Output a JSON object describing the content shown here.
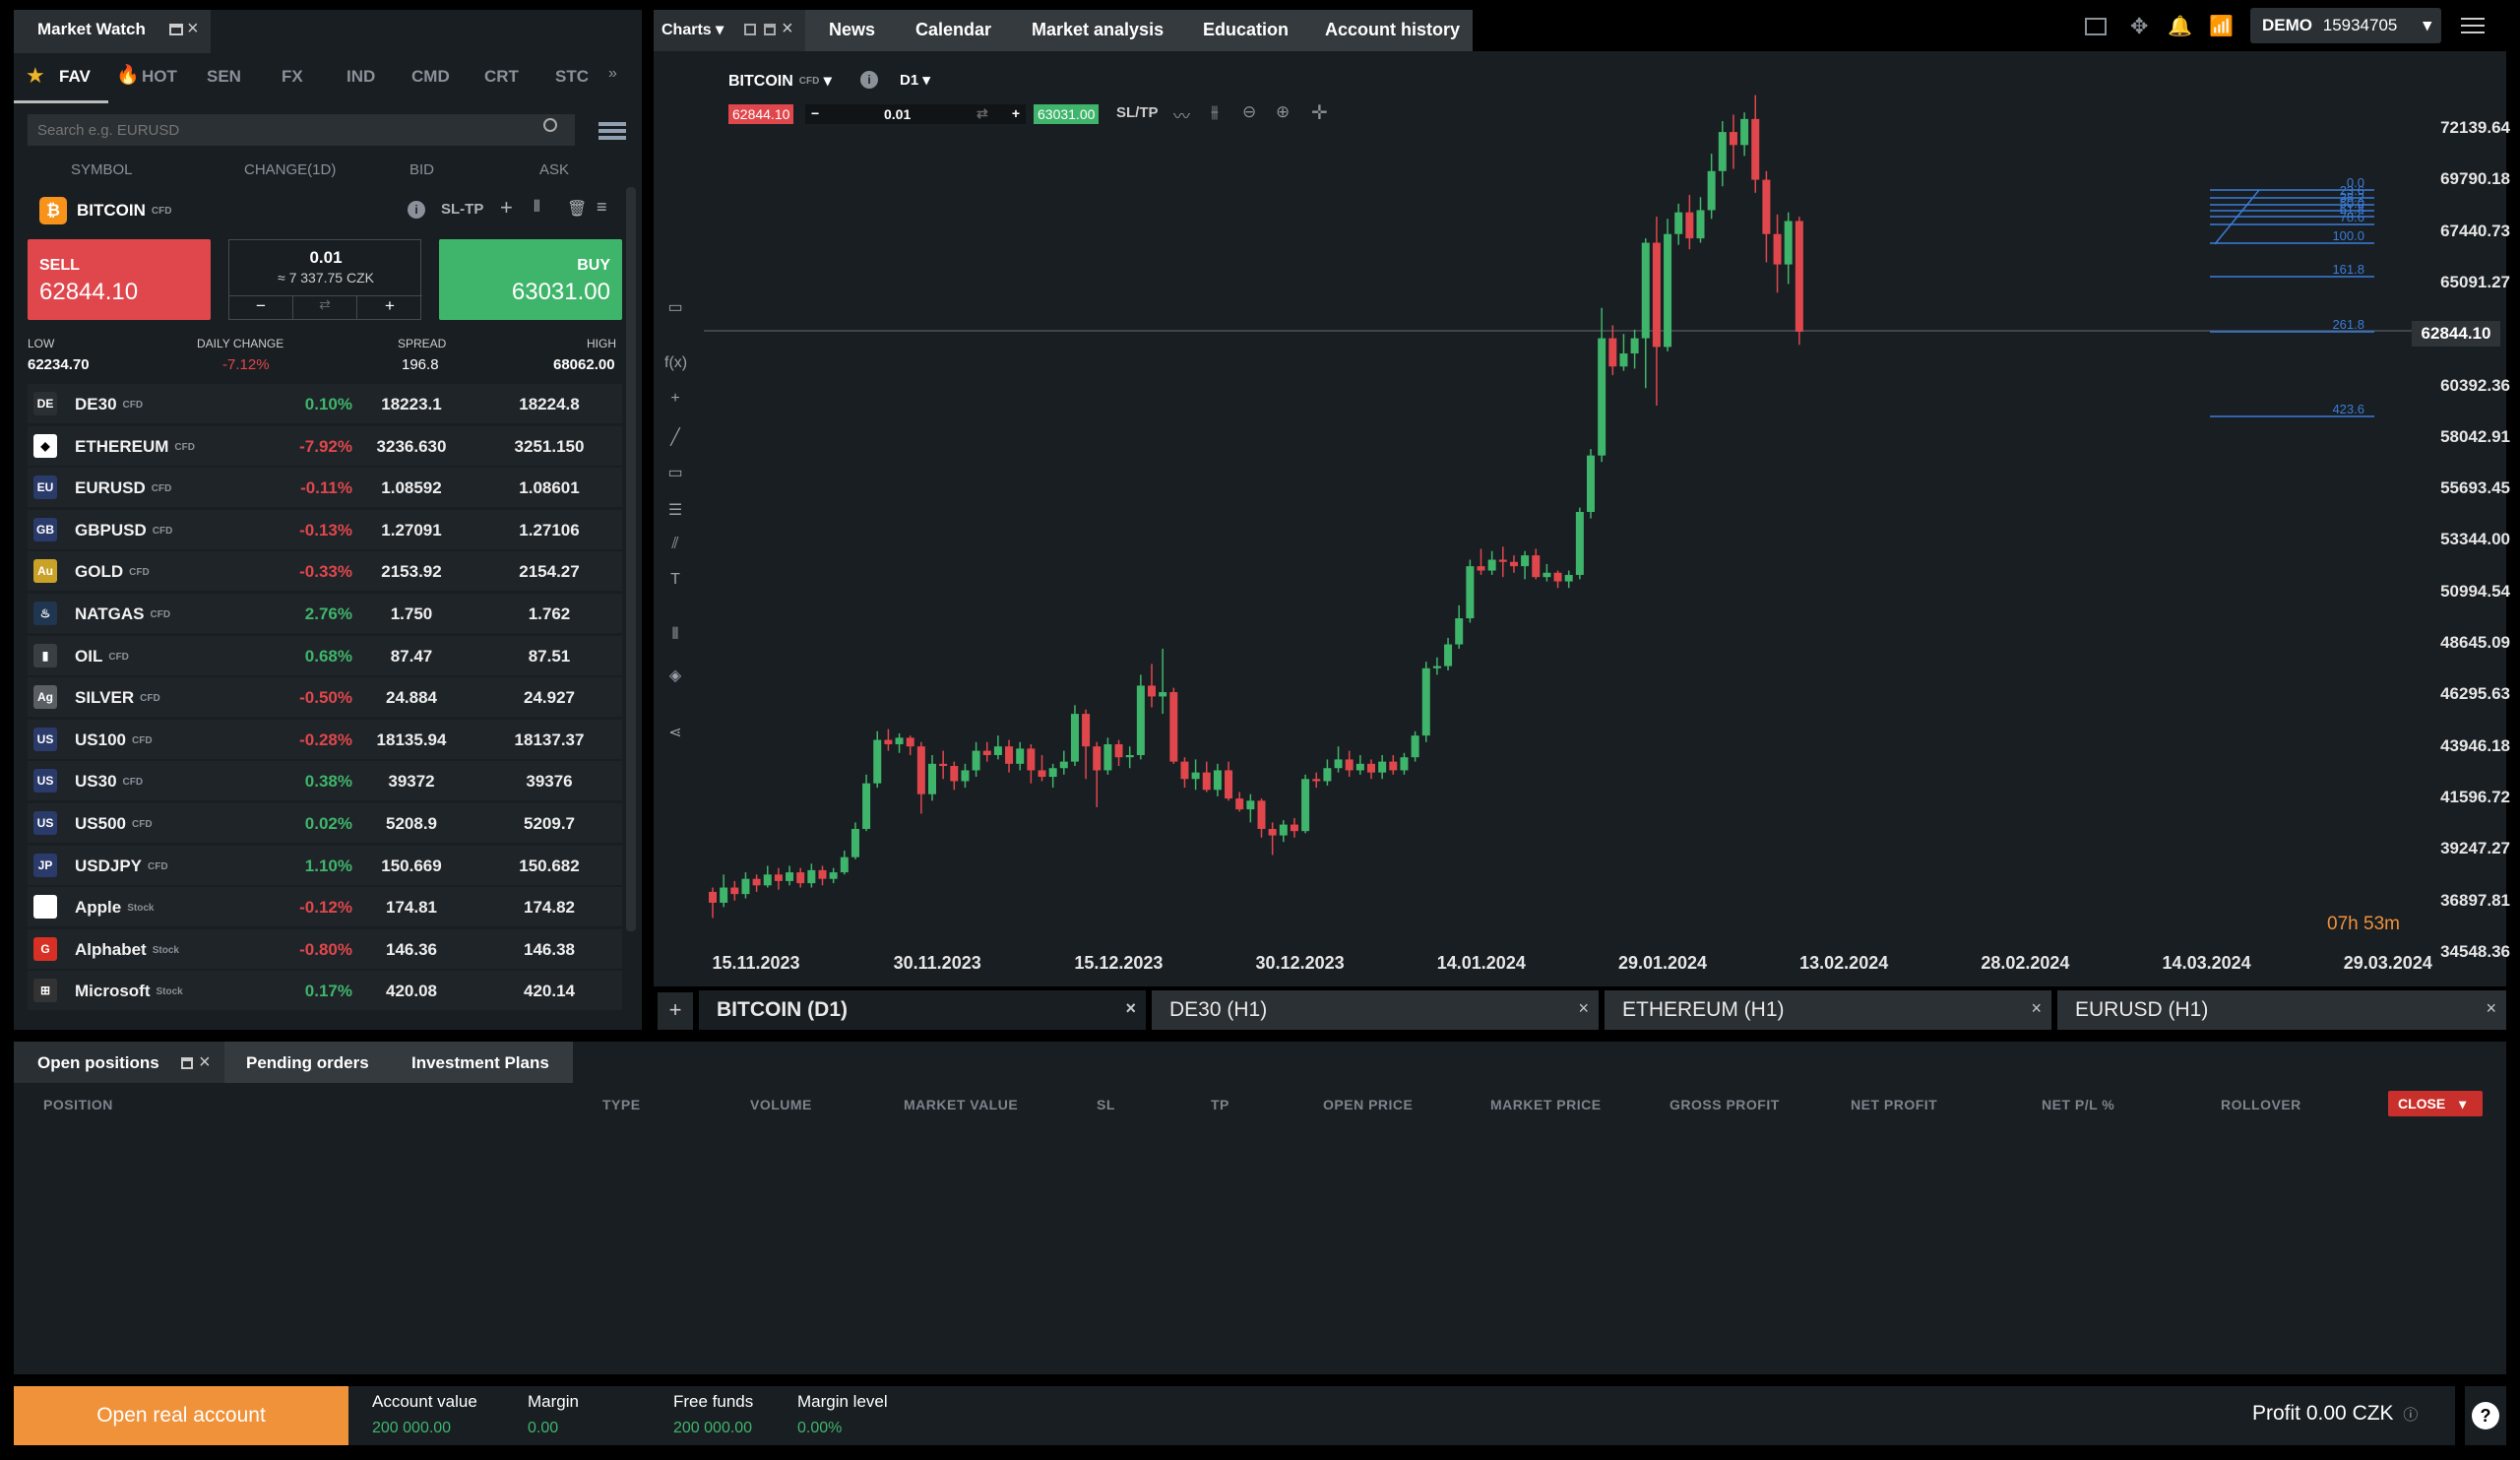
{
  "market_watch": {
    "title": "Market Watch",
    "tabs": [
      "FAV",
      "HOT",
      "SEN",
      "FX",
      "IND",
      "CMD",
      "CRT",
      "STC"
    ],
    "search_placeholder": "Search e.g. EURUSD",
    "columns": [
      "SYMBOL",
      "CHANGE(1D)",
      "BID",
      "ASK"
    ],
    "selected": {
      "symbol": "BITCOIN",
      "type": "CFD",
      "sltp": "SL-TP",
      "sell_label": "SELL",
      "sell_price": "62844.10",
      "buy_label": "BUY",
      "buy_price": "63031.00",
      "volume": "0.01",
      "volume_czk": "≈ 7 337.75 CZK",
      "minus": "−",
      "plus": "+",
      "swap": "⇄",
      "low_label": "LOW",
      "low": "62234.70",
      "daily_label": "DAILY CHANGE",
      "daily": "-7.12%",
      "spread_label": "SPREAD",
      "spread": "196.8",
      "high_label": "HIGH",
      "high": "68062.00"
    },
    "rows": [
      {
        "symbol": "DE30",
        "type": "CFD",
        "change": "0.10%",
        "bid": "18223.1",
        "ask": "18224.8",
        "up": true,
        "color": "#2a2f33",
        "flag": "DE"
      },
      {
        "symbol": "ETHEREUM",
        "type": "CFD",
        "change": "-7.92%",
        "bid": "3236.630",
        "ask": "3251.150",
        "up": false,
        "color": "#ffffff",
        "flag": "◆"
      },
      {
        "symbol": "EURUSD",
        "type": "CFD",
        "change": "-0.11%",
        "bid": "1.08592",
        "ask": "1.08601",
        "up": false,
        "color": "#2a3a6a",
        "flag": "EU"
      },
      {
        "symbol": "GBPUSD",
        "type": "CFD",
        "change": "-0.13%",
        "bid": "1.27091",
        "ask": "1.27106",
        "up": false,
        "color": "#2a3a6a",
        "flag": "GB"
      },
      {
        "symbol": "GOLD",
        "type": "CFD",
        "change": "-0.33%",
        "bid": "2153.92",
        "ask": "2154.27",
        "up": false,
        "color": "#c9a227",
        "flag": "Au"
      },
      {
        "symbol": "NATGAS",
        "type": "CFD",
        "change": "2.76%",
        "bid": "1.750",
        "ask": "1.762",
        "up": true,
        "color": "#1f3550",
        "flag": "♨"
      },
      {
        "symbol": "OIL",
        "type": "CFD",
        "change": "0.68%",
        "bid": "87.47",
        "ask": "87.51",
        "up": true,
        "color": "#3a3f44",
        "flag": "▮"
      },
      {
        "symbol": "SILVER",
        "type": "CFD",
        "change": "-0.50%",
        "bid": "24.884",
        "ask": "24.927",
        "up": false,
        "color": "#5a5f64",
        "flag": "Ag"
      },
      {
        "symbol": "US100",
        "type": "CFD",
        "change": "-0.28%",
        "bid": "18135.94",
        "ask": "18137.37",
        "up": false,
        "color": "#2a3a6a",
        "flag": "US"
      },
      {
        "symbol": "US30",
        "type": "CFD",
        "change": "0.38%",
        "bid": "39372",
        "ask": "39376",
        "up": true,
        "color": "#2a3a6a",
        "flag": "US"
      },
      {
        "symbol": "US500",
        "type": "CFD",
        "change": "0.02%",
        "bid": "5208.9",
        "ask": "5209.7",
        "up": true,
        "color": "#2a3a6a",
        "flag": "US"
      },
      {
        "symbol": "USDJPY",
        "type": "CFD",
        "change": "1.10%",
        "bid": "150.669",
        "ask": "150.682",
        "up": true,
        "color": "#2a3a6a",
        "flag": "JP"
      },
      {
        "symbol": "Apple",
        "type": "Stock",
        "change": "-0.12%",
        "bid": "174.81",
        "ask": "174.82",
        "up": false,
        "color": "#ffffff",
        "flag": ""
      },
      {
        "symbol": "Alphabet",
        "type": "Stock",
        "change": "-0.80%",
        "bid": "146.36",
        "ask": "146.38",
        "up": false,
        "color": "#d93025",
        "flag": "G"
      },
      {
        "symbol": "Microsoft",
        "type": "Stock",
        "change": "0.17%",
        "bid": "420.08",
        "ask": "420.14",
        "up": true,
        "color": "#333",
        "flag": "⊞"
      }
    ]
  },
  "top_nav": {
    "charts": "Charts",
    "items": [
      "News",
      "Calendar",
      "Market analysis",
      "Education",
      "Account history"
    ],
    "account_mode": "DEMO",
    "account_id": "15934705"
  },
  "chart": {
    "symbol": "BITCOIN",
    "type": "CFD",
    "timeframe": "D1",
    "sell_price": "62844.10",
    "buy_price": "63031.00",
    "volume": "0.01",
    "sltp": "SL/TP",
    "timer_h": "07",
    "timer_m": "53",
    "current_price": "62844.10",
    "y_ticks": [
      "72139.64",
      "69790.18",
      "67440.73",
      "65091.27",
      "62844.10",
      "60392.36",
      "58042.91",
      "55693.45",
      "53344.00",
      "50994.54",
      "48645.09",
      "46295.63",
      "43946.18",
      "41596.72",
      "39247.27",
      "36897.81",
      "34548.36"
    ],
    "x_ticks": [
      "15.11.2023",
      "30.11.2023",
      "15.12.2023",
      "30.12.2023",
      "14.01.2024",
      "29.01.2024",
      "13.02.2024",
      "28.02.2024",
      "14.03.2024",
      "29.03.2024"
    ],
    "fib_levels": [
      "0.0",
      "23.6",
      "38.2",
      "50.0",
      "61.8",
      "78.6",
      "100.0",
      "161.8",
      "261.8",
      "423.6"
    ],
    "tabs": [
      "BITCOIN (D1)",
      "DE30 (H1)",
      "ETHEREUM (H1)",
      "EURUSD (H1)"
    ]
  },
  "chart_data": {
    "type": "candlestick",
    "title": "BITCOIN",
    "ylim": [
      34548.36,
      72139.64
    ],
    "x": [
      "15.11.2023",
      "30.11.2023",
      "15.12.2023",
      "30.12.2023",
      "14.01.2024",
      "29.01.2024",
      "13.02.2024",
      "28.02.2024",
      "14.03.2024",
      "29.03.2024"
    ],
    "candles": [
      [
        37000,
        36500,
        37200,
        35800
      ],
      [
        36500,
        37200,
        37800,
        36300
      ],
      [
        37200,
        36900,
        37500,
        36600
      ],
      [
        36900,
        37600,
        37900,
        36700
      ],
      [
        37600,
        37300,
        37800,
        37000
      ],
      [
        37300,
        37800,
        38200,
        37200
      ],
      [
        37800,
        37500,
        38100,
        37100
      ],
      [
        37500,
        37900,
        38200,
        37300
      ],
      [
        37900,
        37400,
        38100,
        37200
      ],
      [
        37400,
        38000,
        38300,
        37200
      ],
      [
        38000,
        37600,
        38200,
        37300
      ],
      [
        37600,
        37900,
        38100,
        37400
      ],
      [
        37900,
        38600,
        38900,
        37800
      ],
      [
        38600,
        39900,
        40200,
        38500
      ],
      [
        39900,
        42000,
        42400,
        39800
      ],
      [
        42000,
        44000,
        44400,
        41800
      ],
      [
        44000,
        43800,
        44500,
        43500
      ],
      [
        43800,
        44100,
        44300,
        43400
      ],
      [
        44100,
        43700,
        44200,
        43300
      ],
      [
        43700,
        41500,
        43900,
        40600
      ],
      [
        41500,
        42900,
        43300,
        41200
      ],
      [
        42900,
        42800,
        43500,
        42200
      ],
      [
        42800,
        42100,
        43000,
        41700
      ],
      [
        42100,
        42600,
        42900,
        41800
      ],
      [
        42600,
        43500,
        43900,
        42300
      ],
      [
        43500,
        43300,
        43900,
        43000
      ],
      [
        43300,
        43700,
        44200,
        43100
      ],
      [
        43700,
        42900,
        44000,
        42500
      ],
      [
        42900,
        43600,
        43900,
        42600
      ],
      [
        43600,
        42600,
        43800,
        42000
      ],
      [
        42600,
        42300,
        43300,
        42100
      ],
      [
        42300,
        42700,
        42900,
        41800
      ],
      [
        42700,
        43000,
        43500,
        42400
      ],
      [
        43000,
        45200,
        45600,
        42800
      ],
      [
        45200,
        43700,
        45400,
        42200
      ],
      [
        43700,
        42600,
        43900,
        40900
      ],
      [
        42600,
        43800,
        44100,
        42400
      ],
      [
        43800,
        43200,
        44000,
        42800
      ],
      [
        43200,
        43300,
        43700,
        42700
      ],
      [
        43300,
        46500,
        47000,
        43100
      ],
      [
        46500,
        46000,
        47500,
        45500
      ],
      [
        46000,
        46200,
        48200,
        45200
      ],
      [
        46200,
        43000,
        46400,
        42900
      ],
      [
        43000,
        42200,
        43200,
        41800
      ],
      [
        42200,
        42500,
        43100,
        41700
      ],
      [
        42500,
        41700,
        43000,
        41600
      ],
      [
        41700,
        42600,
        42900,
        41400
      ],
      [
        42600,
        41300,
        43000,
        41200
      ],
      [
        41300,
        40800,
        41600,
        40700
      ],
      [
        40800,
        41200,
        41500,
        40200
      ],
      [
        41200,
        39900,
        41300,
        39500
      ],
      [
        39900,
        39600,
        40200,
        38700
      ],
      [
        39600,
        40100,
        40300,
        39300
      ],
      [
        40100,
        39800,
        40400,
        39500
      ],
      [
        39800,
        42200,
        42400,
        39700
      ],
      [
        42200,
        42100,
        42500,
        41800
      ],
      [
        42100,
        42700,
        43100,
        41900
      ],
      [
        42700,
        43100,
        43700,
        42500
      ],
      [
        43100,
        42600,
        43500,
        42300
      ],
      [
        42600,
        42900,
        43300,
        42400
      ],
      [
        42900,
        42500,
        43100,
        42200
      ],
      [
        42500,
        43000,
        43300,
        42200
      ],
      [
        43000,
        42600,
        43300,
        42400
      ],
      [
        42600,
        43200,
        43400,
        42400
      ],
      [
        43200,
        44200,
        44400,
        43000
      ],
      [
        44200,
        47300,
        47600,
        43900
      ],
      [
        47300,
        47400,
        47800,
        47000
      ],
      [
        47400,
        48400,
        48700,
        47200
      ],
      [
        48400,
        49600,
        50200,
        48200
      ],
      [
        49600,
        52000,
        52300,
        49400
      ],
      [
        52000,
        51800,
        52800,
        51600
      ],
      [
        51800,
        52300,
        52700,
        51600
      ],
      [
        52300,
        52200,
        52900,
        51500
      ],
      [
        52200,
        52000,
        52500,
        51700
      ],
      [
        52000,
        52500,
        52700,
        51400
      ],
      [
        52500,
        51500,
        52800,
        51400
      ],
      [
        51500,
        51700,
        52100,
        51300
      ],
      [
        51700,
        51300,
        51800,
        51000
      ],
      [
        51300,
        51600,
        51800,
        51000
      ],
      [
        51600,
        54500,
        54700,
        51400
      ],
      [
        54500,
        57100,
        57400,
        54200
      ],
      [
        57100,
        62500,
        63900,
        56800
      ],
      [
        62500,
        61200,
        63100,
        60800
      ],
      [
        61200,
        61800,
        62700,
        61000
      ],
      [
        61800,
        62500,
        62900,
        61100
      ],
      [
        62500,
        66900,
        67100,
        60200
      ],
      [
        66900,
        62100,
        68100,
        59400
      ],
      [
        62100,
        67300,
        68000,
        61900
      ],
      [
        67300,
        68300,
        68700,
        66800
      ],
      [
        68300,
        67100,
        69100,
        66600
      ],
      [
        67100,
        68400,
        69000,
        66900
      ],
      [
        68400,
        70200,
        71000,
        68000
      ],
      [
        70200,
        72000,
        72500,
        69500
      ],
      [
        72000,
        71400,
        72800,
        70300
      ],
      [
        71400,
        72600,
        72900,
        70900
      ],
      [
        72600,
        69800,
        73700,
        69200
      ],
      [
        69800,
        67300,
        70200,
        66000
      ],
      [
        67300,
        65900,
        68200,
        64600
      ],
      [
        65900,
        67900,
        68300,
        65000
      ],
      [
        67900,
        62800,
        68100,
        62200
      ]
    ]
  },
  "positions": {
    "tabs": [
      "Open positions",
      "Pending orders",
      "Investment Plans"
    ],
    "columns": [
      "POSITION",
      "TYPE",
      "VOLUME",
      "MARKET VALUE",
      "SL",
      "TP",
      "OPEN PRICE",
      "MARKET PRICE",
      "GROSS PROFIT",
      "NET PROFIT",
      "NET P/L %",
      "ROLLOVER"
    ],
    "close_label": "CLOSE"
  },
  "footer": {
    "open_real": "Open real account",
    "account_value_label": "Account value",
    "account_value": "200 000.00",
    "margin_label": "Margin",
    "margin": "0.00",
    "free_funds_label": "Free funds",
    "free_funds": "200 000.00",
    "margin_level_label": "Margin level",
    "margin_level": "0.00%",
    "profit_label": "Profit",
    "profit": "0.00 CZK",
    "help": "?"
  }
}
